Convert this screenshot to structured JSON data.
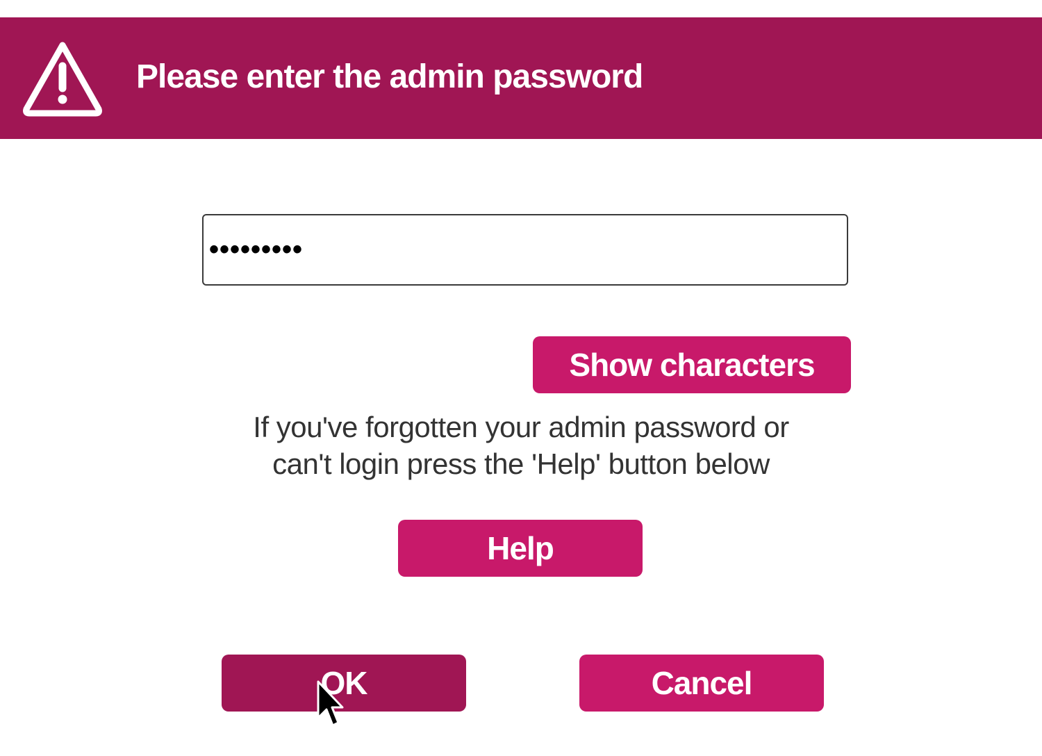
{
  "header": {
    "title": "Please enter the admin password",
    "icon": "warning-triangle-icon",
    "background_color": "#a01654"
  },
  "password_field": {
    "value": "•••••••••",
    "masked": true
  },
  "buttons": {
    "show_characters_label": "Show characters",
    "help_label": "Help",
    "ok_label": "OK",
    "cancel_label": "Cancel"
  },
  "help_text": {
    "line1": "If you've forgotten your admin password or",
    "line2": "can't login press the 'Help' button below"
  },
  "colors": {
    "accent": "#c8196a",
    "accent_dark": "#a01654",
    "text": "#333333"
  }
}
